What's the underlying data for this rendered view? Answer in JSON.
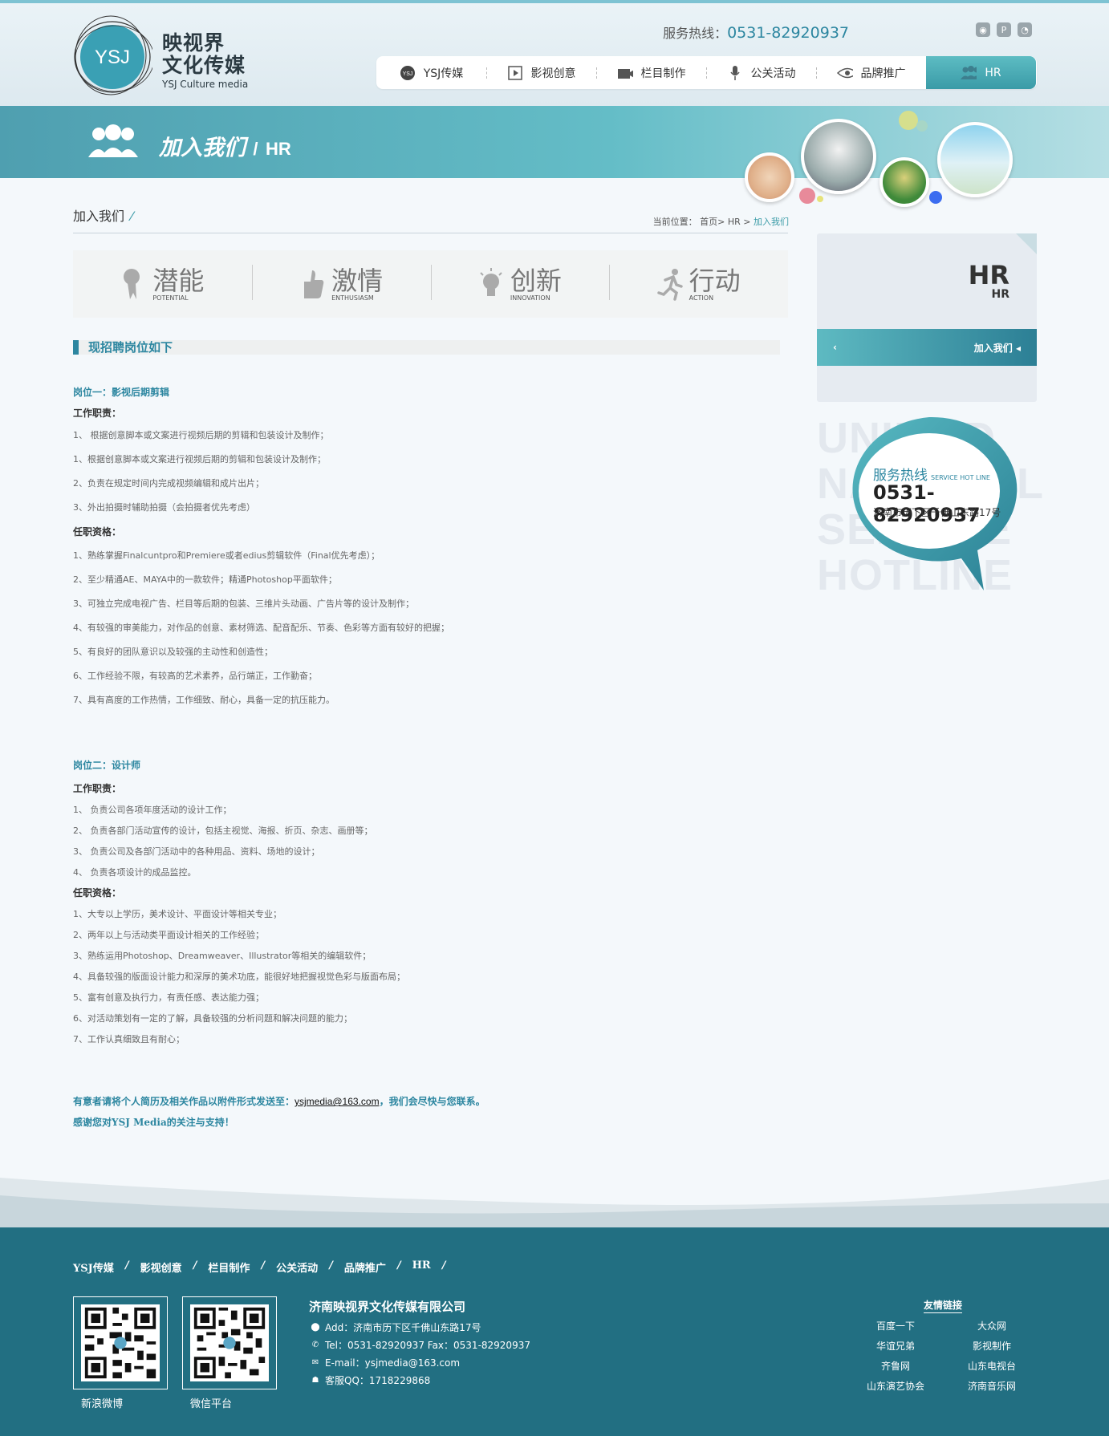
{
  "header": {
    "logo_mark": "YSJ",
    "logo_cn_line1": "映视界",
    "logo_cn_line2": "文化传媒",
    "logo_en": "YSJ Culture media",
    "hotline_label": "服务热线：",
    "hotline_number": "0531-82920937",
    "social_icons": [
      "weibo-icon",
      "p-icon",
      "wechat-icon"
    ]
  },
  "nav": {
    "items": [
      {
        "label": "YSJ传媒",
        "icon": "ysj-icon"
      },
      {
        "label": "影视创意",
        "icon": "play-icon"
      },
      {
        "label": "栏目制作",
        "icon": "camera-icon"
      },
      {
        "label": "公关活动",
        "icon": "mic-icon"
      },
      {
        "label": "品牌推广",
        "icon": "eye-icon"
      },
      {
        "label": "HR",
        "icon": "people-icon"
      }
    ],
    "active": "HR"
  },
  "banner": {
    "title": "加入我们",
    "sep": "/",
    "subtitle": "HR"
  },
  "breadcrumb": {
    "title": "加入我们",
    "slash": "⁄",
    "label": "当前位置：",
    "home": "首页",
    "gt": ">",
    "hr": "HR",
    "current": "加入我们"
  },
  "values": [
    {
      "cn": "潜能",
      "en": "POTENTIAL"
    },
    {
      "cn": "激情",
      "en": "ENTHUSIASM"
    },
    {
      "cn": "创新",
      "en": "INNOVATION"
    },
    {
      "cn": "行动",
      "en": "ACTION"
    }
  ],
  "section_title": "现招聘岗位如下",
  "job1": {
    "title": "岗位一：影视后期剪辑",
    "duty_label": "工作职责：",
    "duties": [
      "1、 根据创意脚本或文案进行视频后期的剪辑和包装设计及制作；",
      "1、根据创意脚本或文案进行视频后期的剪辑和包装设计及制作；",
      "2、负责在规定时间内完成视频编辑和成片出片；",
      "3、外出拍摄时辅助拍摄（会拍摄者优先考虑）"
    ],
    "req_label": "任职资格：",
    "reqs": [
      "1、熟练掌握Finalcuntpro和Premiere或者edius剪辑软件（Final优先考虑）；",
      "2、至少精通AE、MAYA中的一款软件；精通Photoshop平面软件；",
      "3、可独立完成电视广告、栏目等后期的包装、三维片头动画、广告片等的设计及制作；",
      "4、有较强的审美能力，对作品的创意、素材筛选、配音配乐、节奏、色彩等方面有较好的把握；",
      "5、有良好的团队意识以及较强的主动性和创造性；",
      "6、工作经验不限，有较高的艺术素养，品行端正，工作勤奋；",
      "7、具有高度的工作热情，工作细致、耐心，具备一定的抗压能力。"
    ]
  },
  "job2": {
    "title": "岗位二：设计师",
    "duty_label": "工作职责：",
    "duties": [
      "1、 负责公司各项年度活动的设计工作；",
      "2、 负责各部门活动宣传的设计，包括主视觉、海报、折页、杂志、画册等；",
      "3、 负责公司及各部门活动中的各种用品、资料、场地的设计；",
      "4、 负责各项设计的成品监控。"
    ],
    "req_label": "任职资格：",
    "reqs": [
      "1、大专以上学历，美术设计、平面设计等相关专业；",
      "2、两年以上与活动类平面设计相关的工作经验；",
      "3、熟练运用Photoshop、Dreamweaver、Illustrator等相关的编辑软件；",
      "4、具备较强的版面设计能力和深厚的美术功底，能很好地把握视觉色彩与版面布局；",
      "5、富有创意及执行力，有责任感、表达能力强；",
      "6、对活动策划有一定的了解，具备较强的分析问题和解决问题的能力；",
      "7、工作认真细致且有耐心；"
    ]
  },
  "contact": {
    "prefix": "有意者请将个人简历及相关作品以附件形式发送至：",
    "email": "ysjmedia@163.com",
    "suffix": "，我们会尽快与您联系。",
    "thanks": "感谢您对YSJ Media的关注与支持！"
  },
  "sidebar": {
    "hr_big": "HR",
    "hr_small": "HR",
    "menu_label": "加入我们",
    "hotline_bg": [
      "UNIFIED",
      "NATIONAL",
      "SERVICE",
      "HOTLINE"
    ],
    "hotline_title": "服务热线",
    "hotline_en": "SERVICE HOT LINE",
    "hotline_number": "0531-82920937",
    "hotline_addr": "济南市历下区千佛山东路17号"
  },
  "footer": {
    "nav": [
      "YSJ传媒",
      "影视创意",
      "栏目制作",
      "公关活动",
      "品牌推广",
      "HR"
    ],
    "sep": "/",
    "qr1_caption": "新浪微博",
    "qr2_caption": "微信平台",
    "company": "济南映视界文化传媒有限公司",
    "address": "Add：济南市历下区千佛山东路17号",
    "tel": "Tel：0531-82920937  Fax：0531-82920937",
    "email": "E-mail：ysjmedia@163.com",
    "qq": "客服QQ：1718229868",
    "links_title": "友情链接",
    "links": [
      "百度一下",
      "大众网",
      "华谊兄弟",
      "影视制作",
      "齐鲁网",
      "山东电视台",
      "山东演艺协会",
      "济南音乐网"
    ]
  }
}
